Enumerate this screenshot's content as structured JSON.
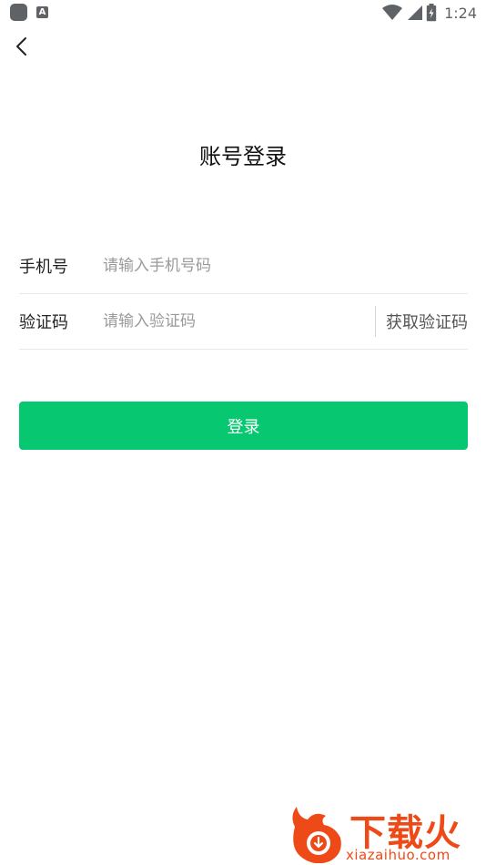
{
  "status_bar": {
    "time": "1:24",
    "a_icon_label": "A",
    "icons": [
      "app-icon",
      "a-icon",
      "wifi-icon",
      "signal-icon",
      "battery-icon"
    ]
  },
  "header": {
    "title": "账号登录"
  },
  "form": {
    "phone": {
      "label": "手机号",
      "placeholder": "请输入手机号码",
      "value": ""
    },
    "code": {
      "label": "验证码",
      "placeholder": "请输入验证码",
      "value": "",
      "get_code_label": "获取验证码"
    }
  },
  "login_button": {
    "label": "登录"
  },
  "watermark": {
    "text": "下载火",
    "subtext": "xiazaihuo.com"
  },
  "colors": {
    "accent": "#07c871",
    "watermark": "#ee4a17",
    "placeholder": "#9a9a9a",
    "divider": "#e8e8e8"
  }
}
